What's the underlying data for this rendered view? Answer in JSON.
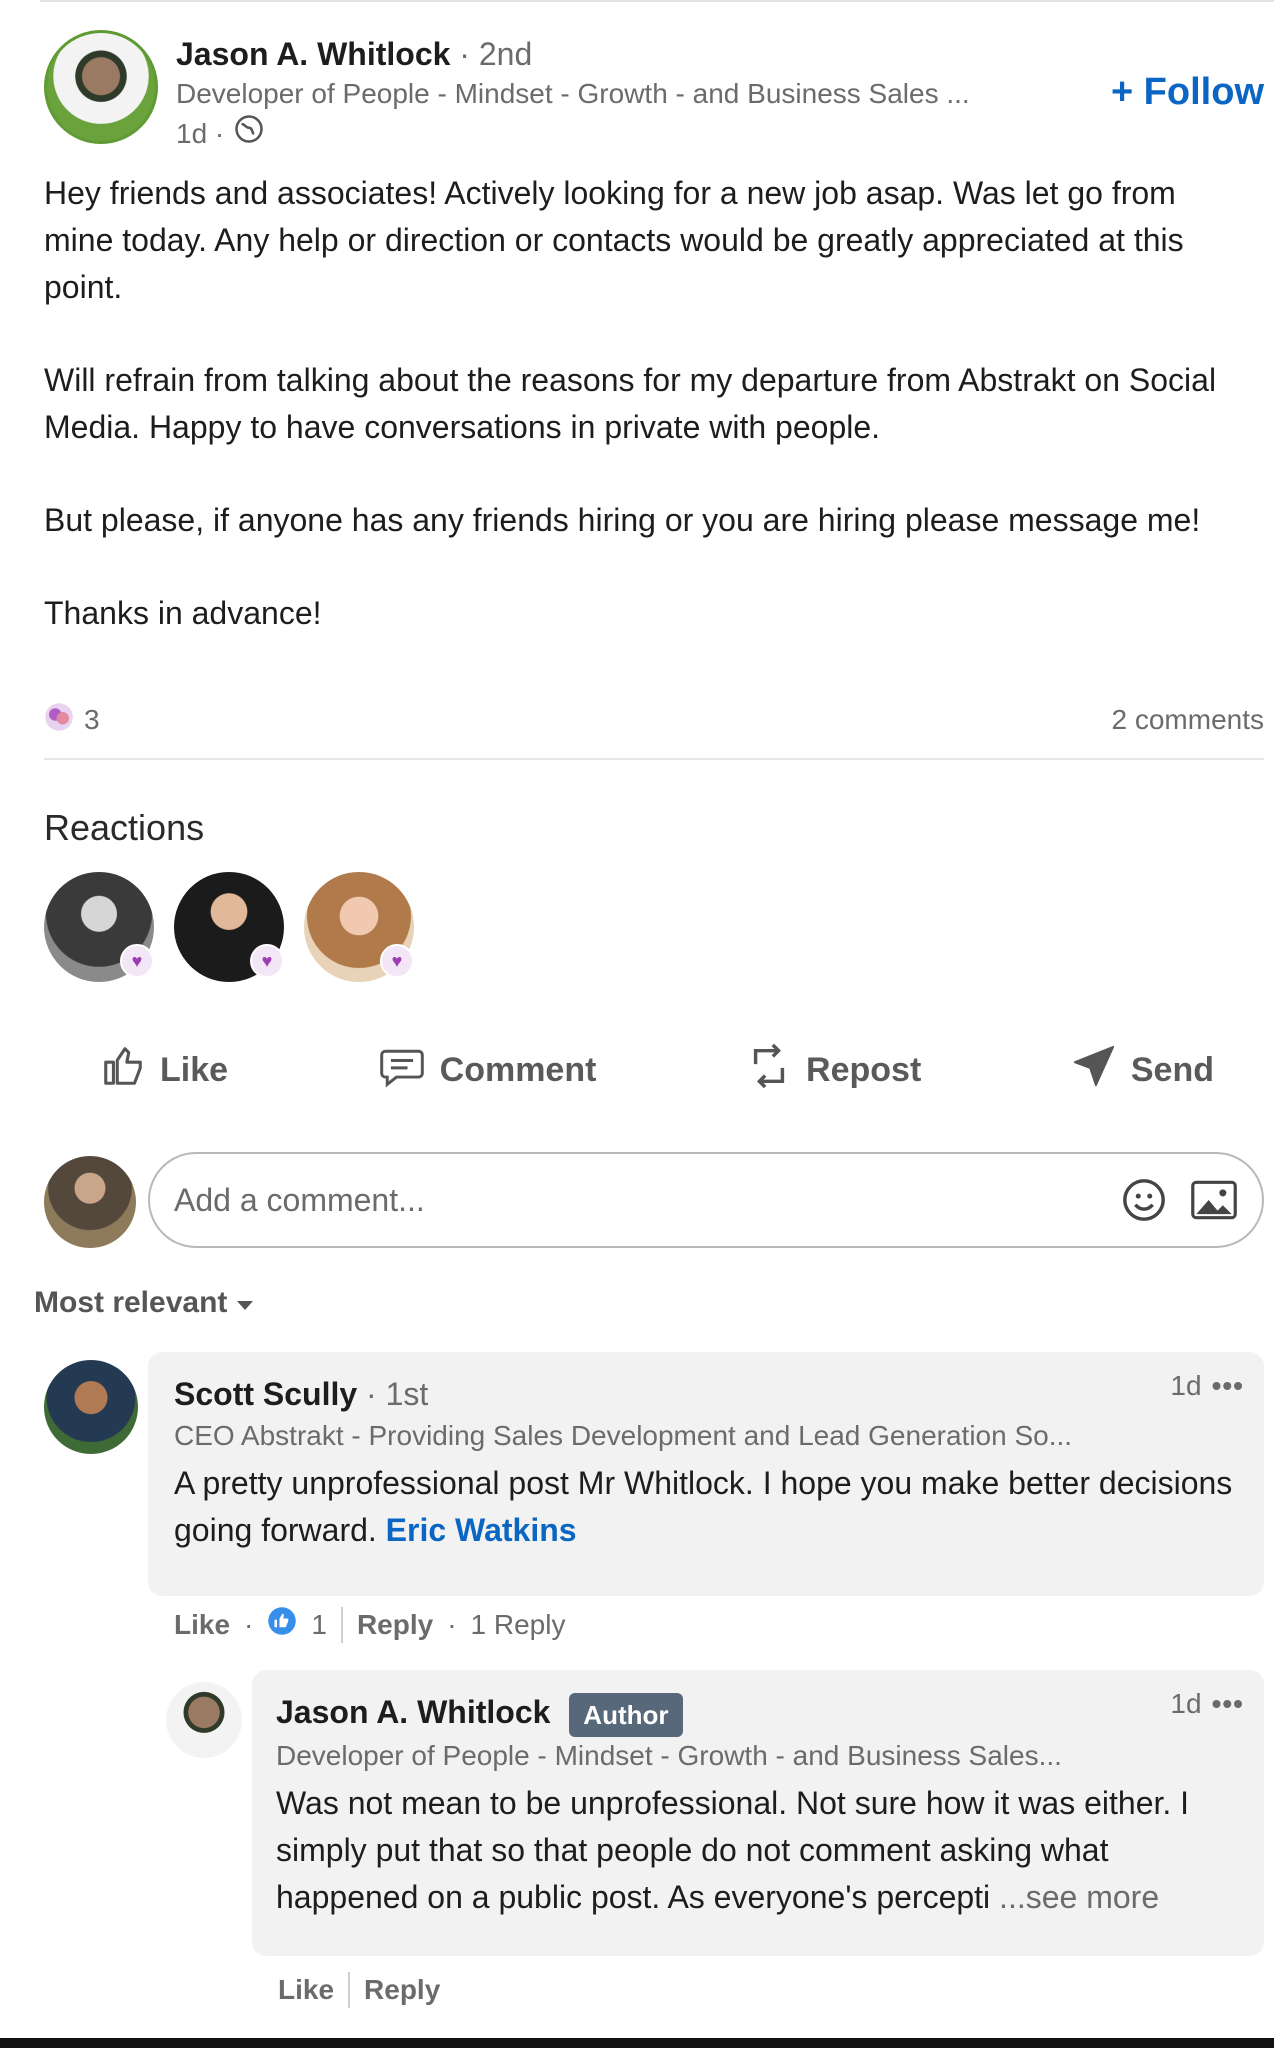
{
  "post": {
    "author_name": "Jason A. Whitlock",
    "connection": "· 2nd",
    "author_title": "Developer of People - Mindset - Growth - and Business Sales ...",
    "time": "1d ·",
    "follow_label": "+ Follow",
    "paragraphs": [
      "Hey friends and associates! Actively looking for a new job asap. Was let go from mine today. Any help or direction or contacts would be greatly appreciated at this point.",
      "Will refrain from talking about the reasons for my departure from Abstrakt on Social Media. Happy to have conversations in private with people.",
      "But please, if anyone has any friends hiring or you are hiring please message me!",
      "Thanks in advance!"
    ],
    "reaction_count": "3",
    "comment_count": "2 comments"
  },
  "reactions": {
    "title": "Reactions"
  },
  "actions": {
    "like": "Like",
    "comment": "Comment",
    "repost": "Repost",
    "send": "Send"
  },
  "composer": {
    "placeholder": "Add a comment..."
  },
  "sort": {
    "label": "Most relevant"
  },
  "comments": [
    {
      "name": "Scott Scully",
      "connection": "· 1st",
      "time": "1d",
      "title": "CEO Abstrakt - Providing Sales Development and Lead Generation So...",
      "text": "A pretty unprofessional post Mr Whitlock. I hope you make better decisions going forward.",
      "mention": "Eric Watkins",
      "like": "Like",
      "like_count": "1",
      "reply": "Reply",
      "replies": "1 Reply"
    },
    {
      "name": "Jason A. Whitlock",
      "badge": "Author",
      "time": "1d",
      "title": "Developer of People - Mindset - Growth - and Business Sales...",
      "text": "Was not mean to be unprofessional. Not sure how it was either. I simply put that so that people do not comment asking what happened on a public post. As everyone's percepti",
      "see_more": "...see more",
      "like": "Like",
      "reply": "Reply"
    }
  ],
  "colors": {
    "accent": "#0a66c2",
    "muted": "#6b6b6b",
    "bubble": "#f2f2f2",
    "author_badge": "#56687a"
  }
}
